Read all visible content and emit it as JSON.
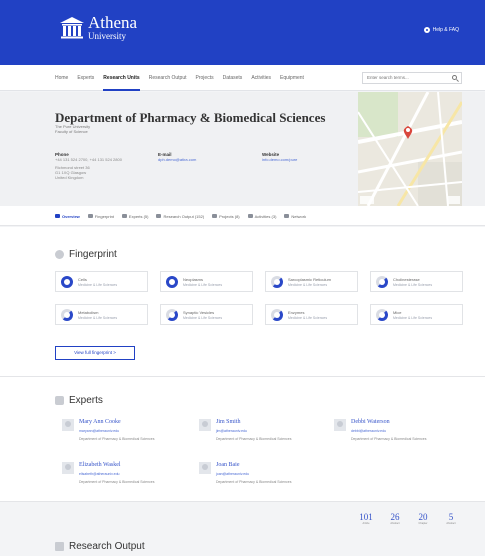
{
  "header": {
    "logo_name": "Athena",
    "logo_sub": "University",
    "help_label": "Help & FAQ"
  },
  "nav": {
    "items": [
      "Home",
      "Experts",
      "Research Units",
      "Research Output",
      "Projects",
      "Datasets",
      "Activities",
      "Equipment"
    ],
    "active_index": 2,
    "search_placeholder": "Enter search terms..."
  },
  "department": {
    "title": "Department of Pharmacy & Biomedical Sciences",
    "sub1": "The Pure University",
    "sub2": "Faculty of Science",
    "phone_label": "Phone",
    "phone_value": "+44 131 524 2700, +44 131 524 2800",
    "address1": "Richmond street 36",
    "address2": "G1 1XQ Glasgow",
    "address3": "United Kingdom",
    "email_label": "E-mail",
    "email_value": "dph.demo@atira.com",
    "website_label": "Website",
    "website_value": "info.demo.com/pure"
  },
  "tabs": {
    "items": [
      "Overview",
      "Fingerprint",
      "Experts (5)",
      "Research Output (152)",
      "Projects (8)",
      "Activities (3)",
      "Network"
    ],
    "active_index": 0
  },
  "fingerprint": {
    "title": "Fingerprint",
    "concepts": [
      {
        "name": "Cells",
        "category": "Medicine & Life Sciences",
        "half": false
      },
      {
        "name": "Neoplasms",
        "category": "Medicine & Life Sciences",
        "half": false
      },
      {
        "name": "Sarcoplasmic Reticulum",
        "category": "Medicine & Life Sciences",
        "half": true
      },
      {
        "name": "Cholinesterase",
        "category": "Medicine & Life Sciences",
        "half": true
      },
      {
        "name": "Metabolism",
        "category": "Medicine & Life Sciences",
        "half": true
      },
      {
        "name": "Synaptic Vesicles",
        "category": "Medicine & Life Sciences",
        "half": true
      },
      {
        "name": "Enzymes",
        "category": "Medicine & Life Sciences",
        "half": true
      },
      {
        "name": "Mice",
        "category": "Medicine & Life Sciences",
        "half": true
      }
    ],
    "view_full_label": "View full fingerprint  >"
  },
  "experts": {
    "title": "Experts",
    "people": [
      {
        "name": "Mary Ann Cooke",
        "email": "maryann@atherauniv.edu",
        "dept": "Department of Pharmacy & Biomedical Sciences"
      },
      {
        "name": "Jim Smith",
        "email": "jim@atherauniv.edu",
        "dept": "Department of Pharmacy & Biomedical Sciences"
      },
      {
        "name": "Debbi Waterson",
        "email": "debbi@atherauniv.edu",
        "dept": "Department of Pharmacy & Biomedical Sciences"
      },
      {
        "name": "Elizabeth Waskel",
        "email": "elisabeth@atherauniv.edu",
        "dept": "Department of Pharmacy & Biomedical Sciences"
      },
      {
        "name": "Joan Baie",
        "email": "joan@atherauniv.edu",
        "dept": "Department of Pharmacy & Biomedical Sciences"
      }
    ]
  },
  "research_output": {
    "title": "Research Output",
    "stats": [
      {
        "num": "101",
        "label": "Article"
      },
      {
        "num": "26",
        "label": "Abstract"
      },
      {
        "num": "20",
        "label": "Chapter"
      },
      {
        "num": "5",
        "label": "Abstract"
      }
    ]
  },
  "colors": {
    "brand": "#2141c4",
    "link": "#3553c9"
  }
}
